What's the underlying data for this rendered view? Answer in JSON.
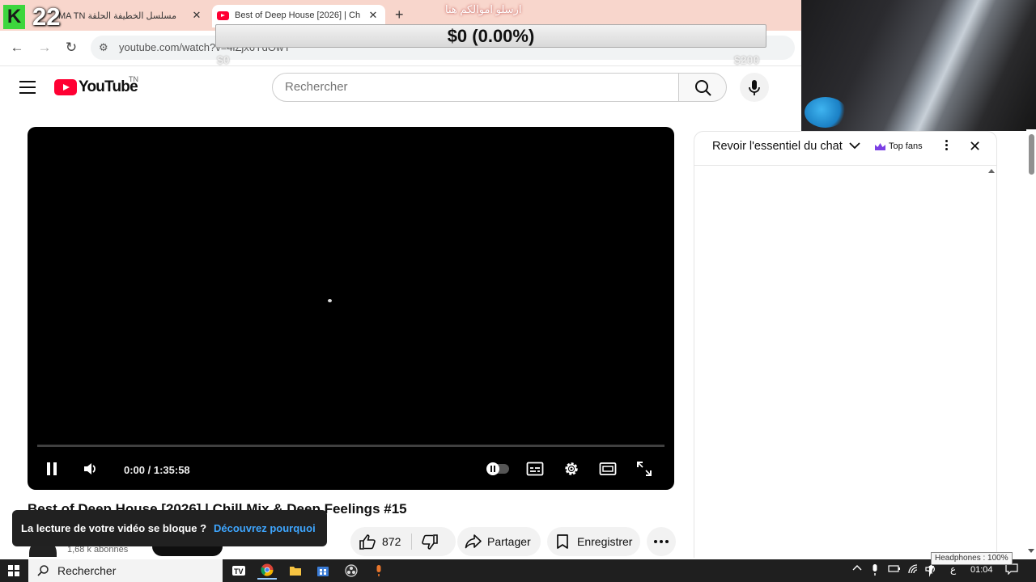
{
  "browser": {
    "tabs": [
      {
        "title": "مسلسل الخطيفة الحلقة MA TN",
        "active": false
      },
      {
        "title": "Best of Deep House [2026] | Ch",
        "active": true
      }
    ],
    "new_tab": "+",
    "url": "youtube.com/watch?v=4iZjx6YdOwY",
    "close_glyph": "✕"
  },
  "overlay": {
    "badge_letter": "K",
    "badge_number": "22",
    "goal_text": "$0 (0.00%)",
    "goal_arabic": "ارسلو اموالكم هنا",
    "goal_min": "$0",
    "goal_max": "$200"
  },
  "youtube": {
    "logo_text": "YouTube",
    "logo_region": "TN",
    "search_placeholder": "Rechercher",
    "player": {
      "time": "0:00 / 1:35:58",
      "progress": 0.0
    },
    "video_title": "Best of Deep House [2026] | Chill Mix & Deep Feelings #15",
    "toast": {
      "message": "La lecture de votre vidéo se bloque ?",
      "link": "Découvrez pourquoi"
    },
    "channel_subscribers": "1,68 k abonnés",
    "actions": {
      "likes": "872",
      "share": "Partager",
      "save": "Enregistrer"
    },
    "chat": {
      "title": "Revoir l'essentiel du chat",
      "top_fans": "Top fans"
    }
  },
  "taskbar": {
    "search_label": "Rechercher",
    "lang": "ع",
    "clock": "01:04",
    "tooltip": "Headphones : 100%"
  },
  "colors": {
    "brand_red": "#ff0033",
    "tab_strip": "#f8d6cc",
    "link_blue": "#3ea6ff",
    "goal_green": "#3dd63d"
  }
}
